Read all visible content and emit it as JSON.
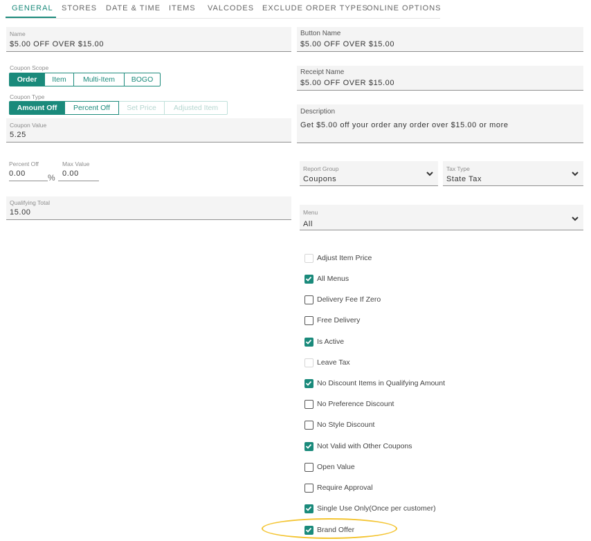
{
  "tabs": [
    "GENERAL",
    "STORES",
    "DATE & TIME",
    "ITEMS",
    "VALCODES",
    "EXCLUDE ORDER TYPES",
    "ONLINE OPTIONS"
  ],
  "active_tab": "GENERAL",
  "name": {
    "label": "Name",
    "value": "$5.00 OFF OVER $15.00"
  },
  "button_name": {
    "label": "Button Name",
    "value": "$5.00 OFF OVER $15.00"
  },
  "receipt_name": {
    "label": "Receipt Name",
    "value": "$5.00 OFF OVER $15.00"
  },
  "description": {
    "label": "Description",
    "value": "Get $5.00 off your order any order over $15.00 or more"
  },
  "coupon_scope": {
    "label": "Coupon Scope",
    "options": [
      "Order",
      "Item",
      "Multi-Item",
      "BOGO"
    ],
    "selected": "Order"
  },
  "coupon_type": {
    "label": "Coupon Type",
    "options": [
      "Amount Off",
      "Percent Off",
      "Set Price",
      "Adjusted Item"
    ],
    "selected": "Amount Off",
    "disabled": [
      "Set Price",
      "Adjusted Item"
    ]
  },
  "coupon_value": {
    "label": "Coupon Value",
    "value": "5.25"
  },
  "percent_off": {
    "label": "Percent Off",
    "value": "0.00",
    "suffix": "%"
  },
  "max_value": {
    "label": "Max Value",
    "value": "0.00"
  },
  "qualifying_total": {
    "label": "Qualifying Total",
    "value": "15.00"
  },
  "report_group": {
    "label": "Report Group",
    "value": "Coupons"
  },
  "tax_type": {
    "label": "Tax Type",
    "value": "State Tax"
  },
  "menu": {
    "label": "Menu",
    "value": "All"
  },
  "checkboxes": [
    {
      "label": "Adjust Item Price",
      "checked": false,
      "disabled": true
    },
    {
      "label": "All Menus",
      "checked": true,
      "disabled": false
    },
    {
      "label": "Delivery Fee If Zero",
      "checked": false,
      "disabled": false
    },
    {
      "label": "Free Delivery",
      "checked": false,
      "disabled": false
    },
    {
      "label": "Is Active",
      "checked": true,
      "disabled": false
    },
    {
      "label": "Leave Tax",
      "checked": false,
      "disabled": true
    },
    {
      "label": "No Discount Items in Qualifying Amount",
      "checked": true,
      "disabled": false
    },
    {
      "label": "No Preference Discount",
      "checked": false,
      "disabled": false
    },
    {
      "label": "No Style Discount",
      "checked": false,
      "disabled": false
    },
    {
      "label": "Not Valid with Other Coupons",
      "checked": true,
      "disabled": false
    },
    {
      "label": "Open Value",
      "checked": false,
      "disabled": false
    },
    {
      "label": "Require Approval",
      "checked": false,
      "disabled": false
    },
    {
      "label": "Single Use Only(Once per customer)",
      "checked": true,
      "disabled": false
    },
    {
      "label": "Brand Offer",
      "checked": true,
      "disabled": false
    }
  ],
  "colors": {
    "accent": "#1a8a7b",
    "highlight": "#f4c430"
  }
}
